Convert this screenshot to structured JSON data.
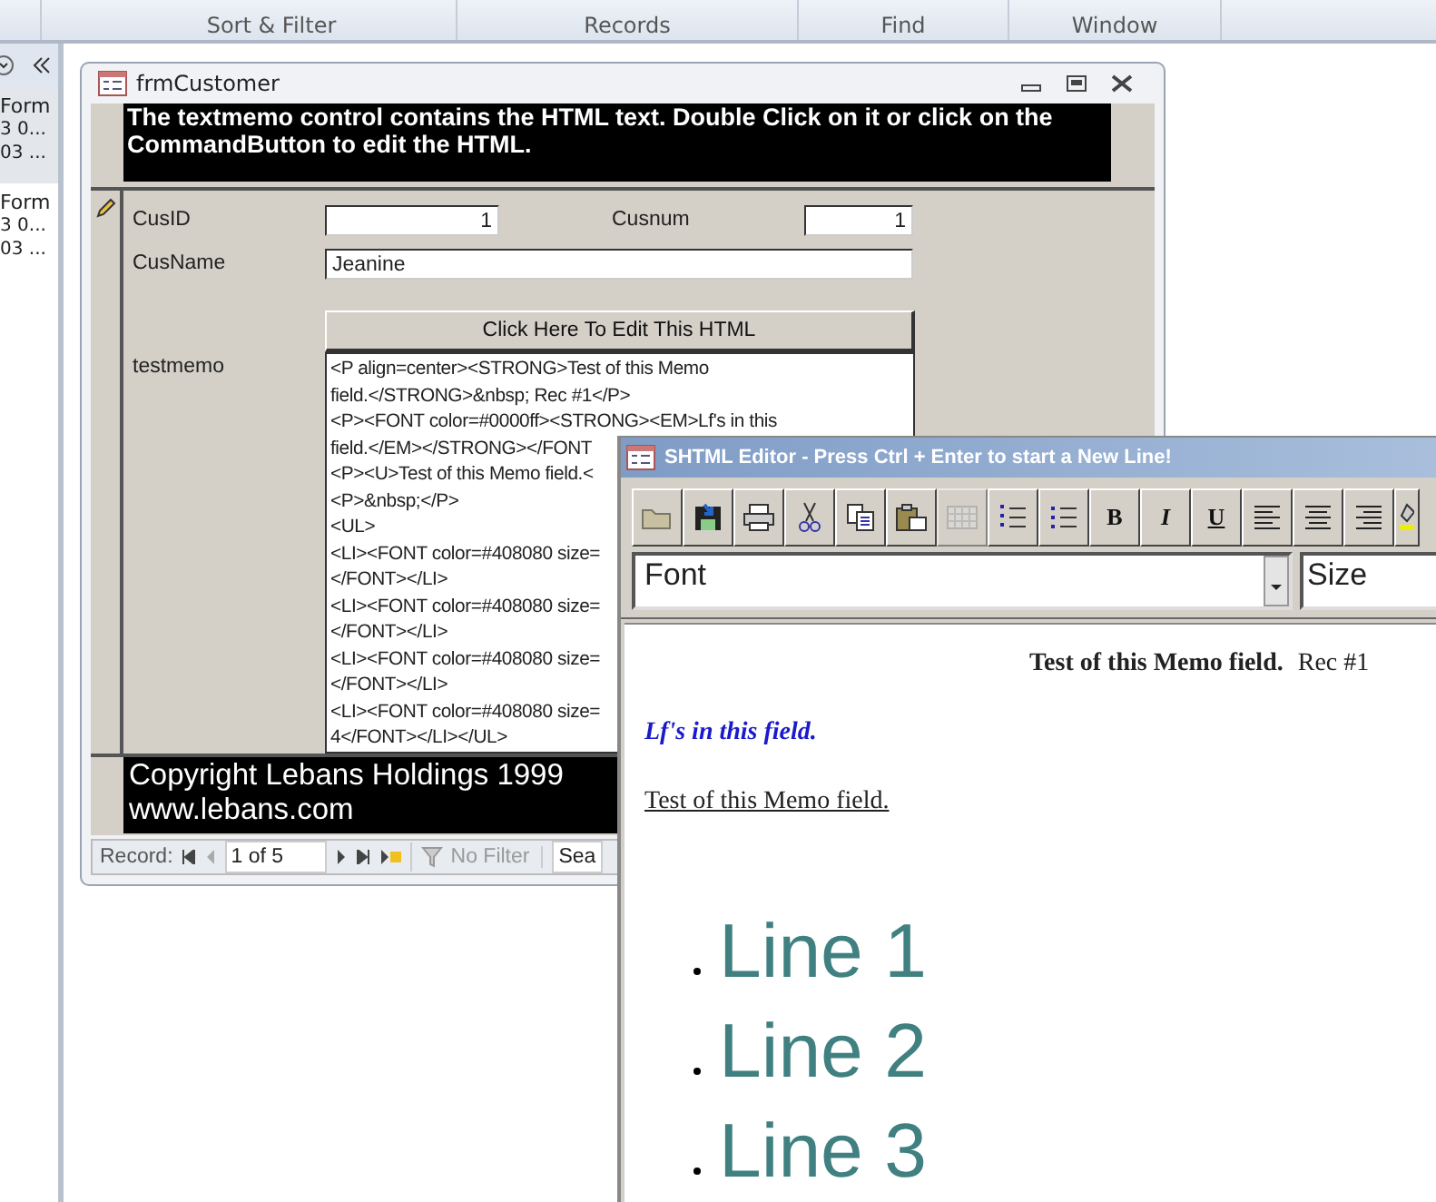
{
  "ribbon": {
    "groups": [
      "Sort & Filter",
      "Records",
      "Find",
      "Window"
    ]
  },
  "nav_pane": {
    "items": [
      {
        "type": "Form",
        "lines": [
          "3 0...",
          "03 ..."
        ],
        "selected": true
      },
      {
        "type": "Form",
        "lines": [
          "3 0...",
          "03 ..."
        ],
        "selected": false
      }
    ]
  },
  "form": {
    "title": "frmCustomer",
    "header_text": "The textmemo control contains the HTML text. Double Click on it or click on the CommandButton to edit the HTML.",
    "fields": [
      {
        "label": "CusID",
        "value": "1"
      },
      {
        "label": "Cusnum",
        "value": "1"
      },
      {
        "label": "CusName",
        "value": "Jeanine"
      }
    ],
    "button": "Click Here To Edit This HTML",
    "memo": {
      "label": "testmemo",
      "lines": [
        "<P align=center><STRONG>Test of this Memo",
        "field.</STRONG>&nbsp; Rec #1</P>",
        "<P><FONT color=#0000ff><STRONG><EM>Lf's in this",
        "field.</EM></STRONG></FONT",
        "<P><U>Test of this Memo field.<",
        "<P>&nbsp;</P>",
        "<UL>",
        "<LI><FONT color=#408080 size=",
        "</FONT></LI>",
        "<LI><FONT color=#408080 size=",
        "</FONT></LI>",
        "<LI><FONT color=#408080 size=",
        "</FONT></LI>",
        "<LI><FONT color=#408080 size=",
        "4</FONT></LI></UL>"
      ]
    },
    "footer": [
      "Copyright Lebans Holdings 1999",
      "www.lebans.com"
    ],
    "record_nav": {
      "label": "Record:",
      "position": "1 of 5",
      "filter": "No Filter",
      "filter_disabled": true,
      "search": "Sea"
    }
  },
  "editor": {
    "title": "SHTML Editor - Press Ctrl + Enter to start a New Line!",
    "active": false,
    "toolbar": [
      {
        "kind": "open",
        "disabled": false
      },
      {
        "kind": "save",
        "disabled": false
      },
      {
        "kind": "print",
        "disabled": false
      },
      {
        "kind": "cut",
        "disabled": false
      },
      {
        "kind": "copy",
        "disabled": false
      },
      {
        "kind": "paste",
        "disabled": false
      },
      {
        "kind": "table",
        "disabled": true
      },
      {
        "kind": "numbered-list",
        "disabled": false
      },
      {
        "kind": "bullet-list",
        "disabled": false
      },
      {
        "kind": "bold",
        "label": "B",
        "disabled": false
      },
      {
        "kind": "italic",
        "label": "I",
        "disabled": false
      },
      {
        "kind": "underline",
        "label": "U",
        "disabled": false
      },
      {
        "kind": "align-left",
        "disabled": false
      },
      {
        "kind": "align-center",
        "disabled": false
      },
      {
        "kind": "align-right",
        "disabled": false
      },
      {
        "kind": "fill",
        "disabled": false
      }
    ],
    "font": "Font",
    "size": "Size",
    "paragraphs": [
      {
        "kind": "heading",
        "text": "Test of this Memo field.",
        "note": "Rec #1"
      },
      {
        "kind": "emphasis",
        "text": "Lf's in this field."
      },
      {
        "kind": "underline",
        "text": "Test of this Memo field."
      }
    ],
    "list": [
      "Line 1",
      "Line 2",
      "Line 3"
    ]
  }
}
